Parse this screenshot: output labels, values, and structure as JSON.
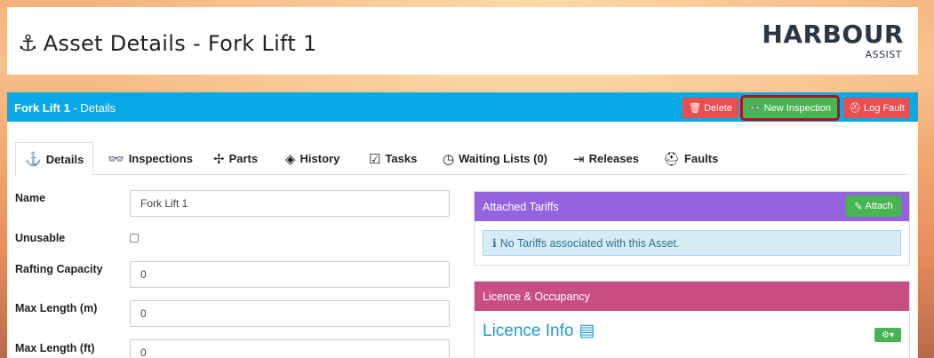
{
  "header": {
    "title": "Asset Details - Fork Lift 1",
    "logo_text": "HARBOUR",
    "logo_sub": "ASSIST"
  },
  "panel": {
    "asset_name": "Fork Lift 1",
    "crumb_suffix": " - Details",
    "buttons": {
      "delete": "Delete",
      "new_inspection": "New Inspection",
      "log_fault": "Log Fault"
    },
    "bar_color": "#07a9e6"
  },
  "tabs": [
    {
      "label": "Details",
      "icon": "anchor-icon"
    },
    {
      "label": "Inspections",
      "icon": "glasses-icon"
    },
    {
      "label": "Parts",
      "icon": "puzzle-icon"
    },
    {
      "label": "History",
      "icon": "layers-icon"
    },
    {
      "label": "Tasks",
      "icon": "clipboard-check-icon"
    },
    {
      "label": "Waiting Lists (0)",
      "icon": "clock-icon"
    },
    {
      "label": "Releases",
      "icon": "sign-out-icon"
    },
    {
      "label": "Faults",
      "icon": "medkit-icon"
    }
  ],
  "form": {
    "name_label": "Name",
    "name_value": "Fork Lift 1",
    "unusable_label": "Unusable",
    "rafting_label": "Rafting Capacity",
    "rafting_value": "0",
    "maxlen_m_label": "Max Length (m)",
    "maxlen_m_value": "0",
    "maxlen_ft_label": "Max Length (ft)",
    "maxlen_ft_value": "0"
  },
  "tariffs": {
    "title": "Attached Tariffs",
    "attach_label": "Attach",
    "empty_message": "No Tariffs associated with this Asset."
  },
  "licence": {
    "title": "Licence & Occupancy",
    "info_title": "Licence Info"
  }
}
